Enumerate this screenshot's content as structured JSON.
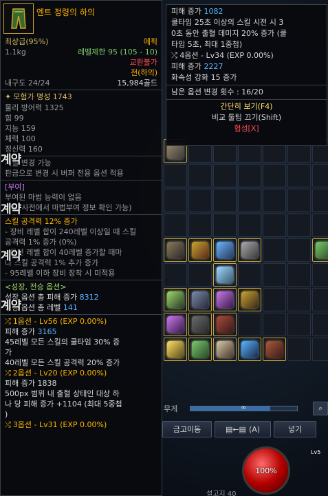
{
  "item": {
    "name": "엔트 정령의 하의",
    "grade": "최상급(95%)",
    "rarity": "에픽",
    "weight": "1.1kg",
    "level_limit": "레벨제한 95 (105 - 10)",
    "trade": "교환불가",
    "type": "천(하의)",
    "durability": "내구도 24/24",
    "price": "15,984골드",
    "fame_label": "모험가 명성 1743",
    "stats": [
      "물리 방어력 1325",
      "힘 99",
      "지능 159",
      "체력 100",
      "정신력 160"
    ],
    "notes": [
      "재질 변경 가능",
      "판금으로 변경 시 버퍼 전용 옵션 적용"
    ],
    "enchant_header": "[부여]",
    "enchant_lines": [
      "부여된 마법 능력이 없음",
      "(백과사전에서 마법부여 정보 확인 가능)"
    ],
    "skill_lines": [
      "스킬 공격력 12% 증가",
      "- 장비 레벨 합이 240레벨 이상일 때 스킬",
      "공격력 1% 증가 (0%)",
      "- 옵션 레벨 합이 40레벨 증가할 때마",
      "다 스킬 공격력 1% 추가 증가",
      "- 95레벨 이하 장비 장착 시 미적용"
    ],
    "growth_header": "<성장, 전승 옵션>",
    "growth_total_dmg_label": "성장 옵션 총 피해 증가",
    "growth_total_dmg": "8312",
    "growth_total_lv_label": "성장 옵션 총 레벨",
    "growth_total_lv": "141",
    "options": [
      {
        "head": "1옵션 - Lv56 (EXP 0.00%)",
        "dmg_label": "피해 증가",
        "dmg": "3165",
        "lines": [
          "45레벨 모든 스킬의 쿨타임 30% 증",
          "가",
          "40레벨 모든 스킬 공격력 20% 증가"
        ]
      },
      {
        "head": "2옵션 - Lv20 (EXP 0.00%)",
        "dmg_label": "피해 증가",
        "dmg": "1838",
        "lines": [
          "500px 범위 내 출혈 상태인 대상 하",
          "나 당 피해 증가 +1104 (최대 5중첩",
          ")"
        ]
      },
      {
        "head": "3옵션 - Lv31 (EXP 0.00%)"
      }
    ],
    "overlay_tag": "계약"
  },
  "tooltip2": {
    "dmg_label": "피해 증가",
    "dmg": "1082",
    "lines": [
      "쿨타임 25초 이상의 스킬 시전 시 3",
      "0초 동안 출혈 데미지 20% 증가 (쿨",
      "타임 5초, 최대 1중첩)"
    ],
    "opt4_head": "4옵션 - Lv34 (EXP 0.00%)",
    "opt4_dmg_label": "피해 증가",
    "opt4_dmg": "2227",
    "opt4_line": "화속성 강화 15 증가",
    "remaining": "남은 옵션 변경 횟수 : 16/20",
    "simple_view": "간단히 보기(F4)",
    "compare_off": "비교 툴팁 끄기(Shift)",
    "collab": "협성[X]"
  },
  "inventory": {
    "weight_label": "무게",
    "weight_mark": "∞",
    "weight_fill": 0.75,
    "btn_storage": "금고이동",
    "btn_a": "(A)",
    "btn_put": "넣기",
    "hp": "100%",
    "lv_badge": "Lv5",
    "bottom_name": "설고지 40"
  }
}
